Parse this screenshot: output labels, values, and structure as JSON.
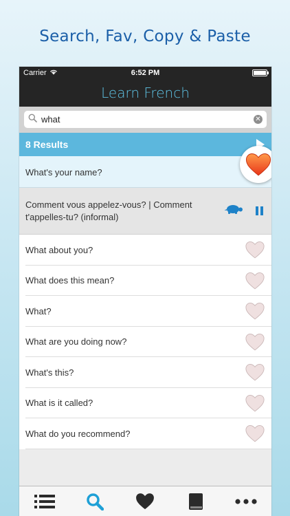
{
  "promo": {
    "title": "Search, Fav, Copy & Paste"
  },
  "status_bar": {
    "carrier": "Carrier",
    "time": "6:52 PM"
  },
  "nav": {
    "title": "Learn French"
  },
  "search": {
    "value": "what"
  },
  "results": {
    "label": "8 Results"
  },
  "selected_item": {
    "phrase": "What's your name?",
    "translation": "Comment vous appelez-vous? | Comment t'appelles-tu? (informal)"
  },
  "items": [
    {
      "phrase": "What about you?"
    },
    {
      "phrase": "What does this mean?"
    },
    {
      "phrase": "What?"
    },
    {
      "phrase": "What are you doing now?"
    },
    {
      "phrase": "What's this?"
    },
    {
      "phrase": "What is it called?"
    },
    {
      "phrase": "What do you recommend?"
    }
  ],
  "tabs": [
    "list-icon",
    "search-icon",
    "heart-icon",
    "book-icon",
    "more-icon"
  ],
  "colors": {
    "accent": "#5cb7dd",
    "nav_title": "#5ec2e4",
    "heart_favorite": "#ef4a21",
    "heart_empty": "#e8d3d3",
    "tab_active": "#1ea0d6",
    "promo_text": "#1b5fa8"
  }
}
